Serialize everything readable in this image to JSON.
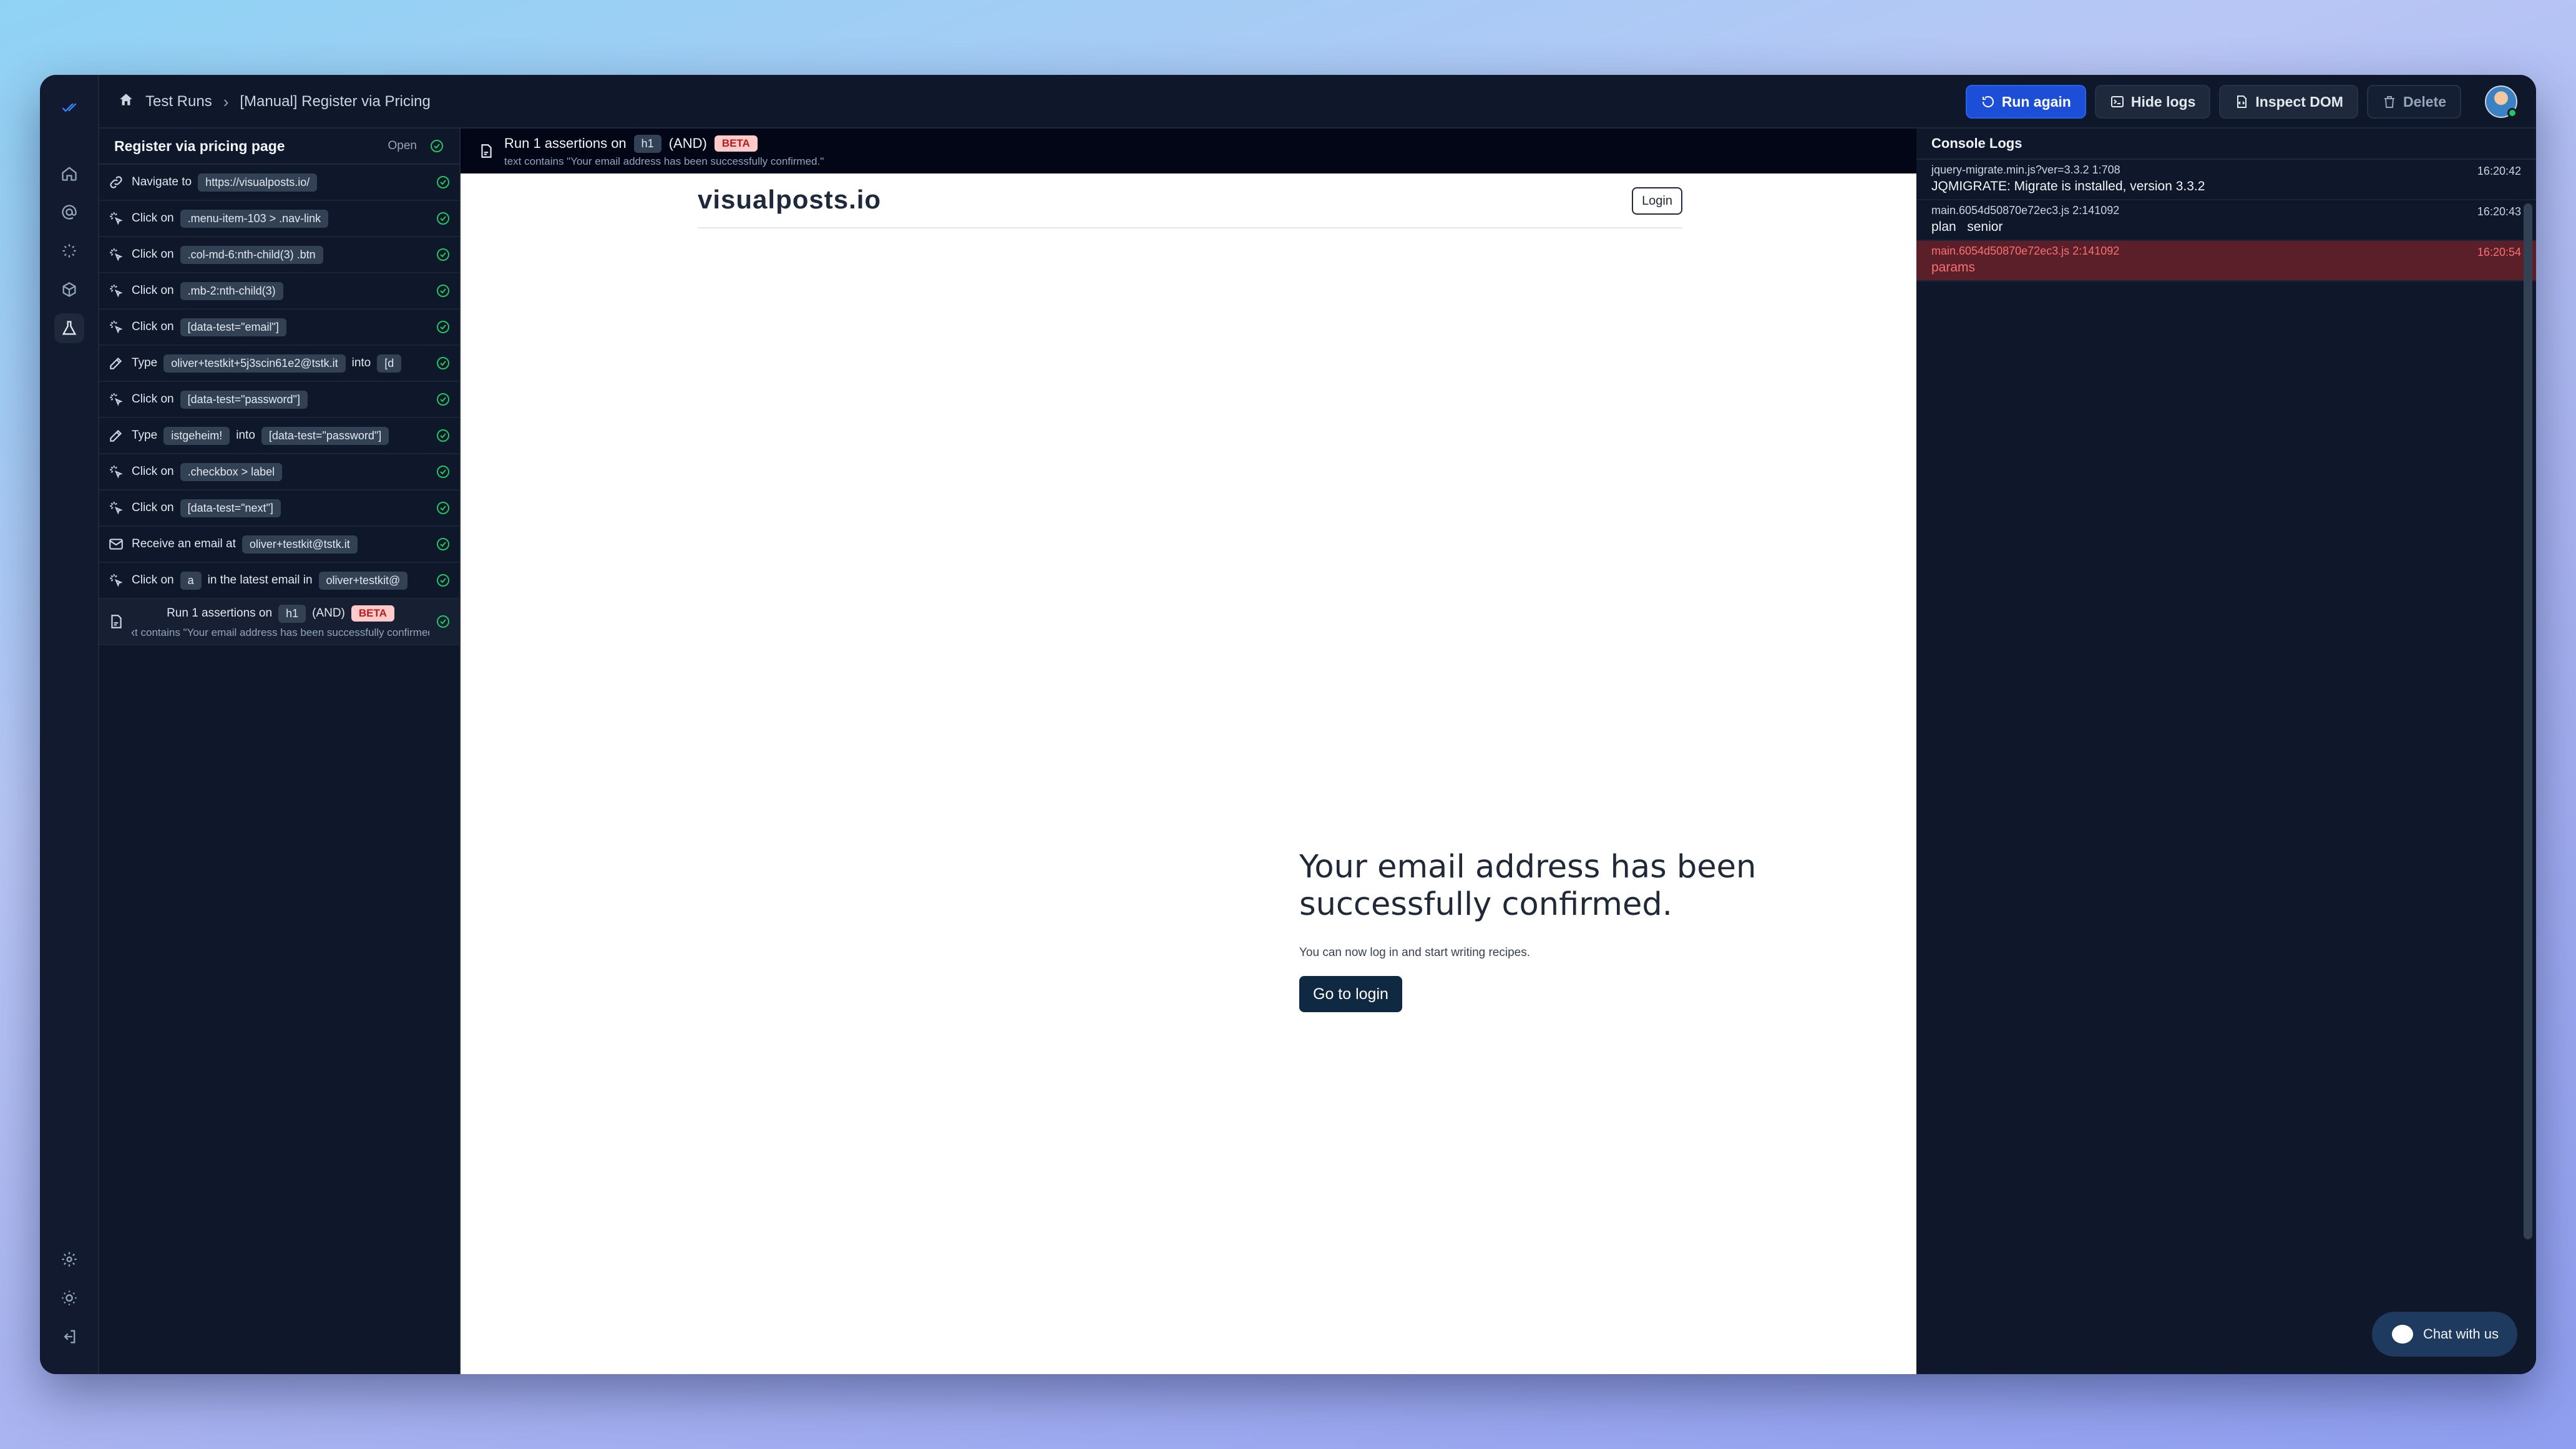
{
  "topbar": {
    "breadcrumb": [
      "Test Runs",
      "[Manual] Register via Pricing"
    ],
    "run_again": "Run again",
    "hide_logs": "Hide logs",
    "inspect_dom": "Inspect DOM",
    "delete": "Delete"
  },
  "steps_panel": {
    "title": "Register via pricing page",
    "open_label": "Open",
    "steps": [
      {
        "action": "Navigate to",
        "target": "https://visualposts.io/"
      },
      {
        "action": "Click on",
        "target": ".menu-item-103 > .nav-link"
      },
      {
        "action": "Click on",
        "target": ".col-md-6:nth-child(3) .btn"
      },
      {
        "action": "Click on",
        "target": ".mb-2:nth-child(3)"
      },
      {
        "action": "Click on",
        "target": "[data-test=\"email\"]"
      },
      {
        "action": "Type",
        "target": "oliver+testkit+5j3scin61e2@tstk.it",
        "connector": "into",
        "target2": "[d"
      },
      {
        "action": "Click on",
        "target": "[data-test=\"password\"]"
      },
      {
        "action": "Type",
        "target": "istgeheim!",
        "connector": "into",
        "target2": "[data-test=\"password\"]"
      },
      {
        "action": "Click on",
        "target": ".checkbox > label"
      },
      {
        "action": "Click on",
        "target": "[data-test=\"next\"]"
      },
      {
        "action": "Receive an email at",
        "target": "oliver+testkit@tstk.it"
      },
      {
        "action": "Click on",
        "target": "a",
        "connector": "in the latest email in",
        "target2": "oliver+testkit@"
      },
      {
        "action": "Run 1 assertions on",
        "target": "h1",
        "connector": "(AND)",
        "badge": "BETA",
        "sub": "text contains \"Your email address has been successfully confirmed.\""
      }
    ]
  },
  "preview": {
    "assert_title": "Run 1 assertions on",
    "assert_target": "h1",
    "assert_op": "(AND)",
    "assert_badge": "BETA",
    "assert_sub": "text contains \"Your email address has been successfully confirmed.\"",
    "logo": "visualposts.io",
    "login": "Login",
    "heading": "Your email address has been successfully confirmed.",
    "paragraph": "You can now log in and start writing recipes.",
    "cta": "Go to login"
  },
  "console": {
    "title": "Console Logs",
    "logs": [
      {
        "source": "jquery-migrate.min.js?ver=3.3.2  1:708",
        "time": "16:20:42",
        "message": "JQMIGRATE: Migrate is installed, version 3.3.2",
        "level": "info"
      },
      {
        "source": "main.6054d50870e72ec3.js  2:141092",
        "time": "16:20:43",
        "message": "plan   senior",
        "level": "info"
      },
      {
        "source": "main.6054d50870e72ec3.js  2:141092",
        "time": "16:20:54",
        "message": "params",
        "level": "error"
      }
    ],
    "chat": "Chat with us"
  },
  "colors": {
    "accent": "#1d4ed8",
    "success": "#22c55e",
    "error_bg": "#5b1f2a",
    "error_text": "#f87171"
  }
}
